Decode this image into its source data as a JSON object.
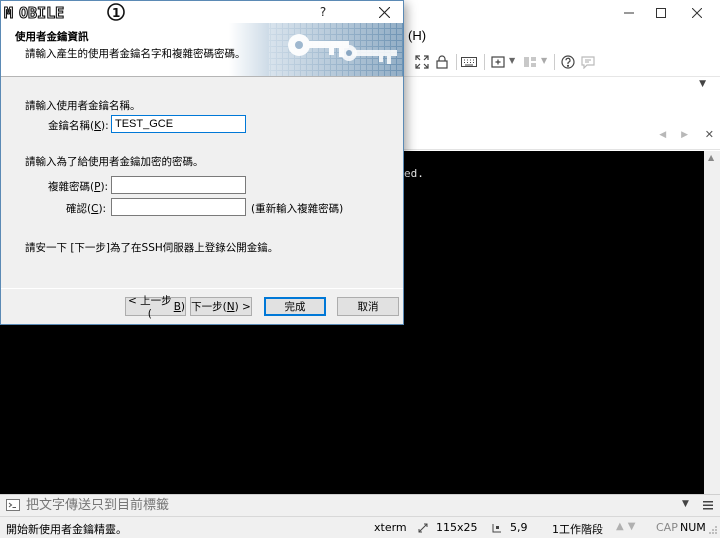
{
  "app": {
    "menu_help": "(H)",
    "terminal_text": "ed.",
    "send_bar_placeholder": "把文字傳送只到目前標籤"
  },
  "statusbar": {
    "message": "開始新使用者金鑰精靈。",
    "terminal_type": "xterm",
    "size": "115x25",
    "position": "5,9",
    "sessions": "1工作階段",
    "cap": "CAP",
    "num": "NUM"
  },
  "dialog": {
    "logo_text": "MOBILE01",
    "help_label": "?",
    "header": {
      "title": "使用者金鑰資訊",
      "subtitle": "請輸入產生的使用者金鑰名字和複雜密碼密碼。"
    },
    "body": {
      "section1": "請輸入使用者金鑰名稱。",
      "key_name_label": "金鑰名稱(",
      "key_name_hotkey": "K",
      "key_name_value": "TEST_GCE",
      "section2": "請輸入為了給使用者金鑰加密的密碼。",
      "passphrase_label": "複雜密碼(",
      "passphrase_hotkey": "P",
      "confirm_label": "確認(",
      "confirm_hotkey": "C",
      "confirm_hint": "(重新輸入複雜密碼)",
      "footer_note": "請安一下 [下一步]為了在SSH伺服器上登錄公開金鑰。"
    },
    "buttons": {
      "back_prefix": "< 上一步(",
      "back_hotkey": "B",
      "next_prefix": "下一步(",
      "next_hotkey": "N",
      "next_suffix": ") >",
      "finish": "完成",
      "cancel": "取消"
    }
  },
  "colors": {
    "focus_blue": "#0078d7",
    "terminal_bg": "#000000",
    "banner_blue": "#7fa2c0"
  }
}
